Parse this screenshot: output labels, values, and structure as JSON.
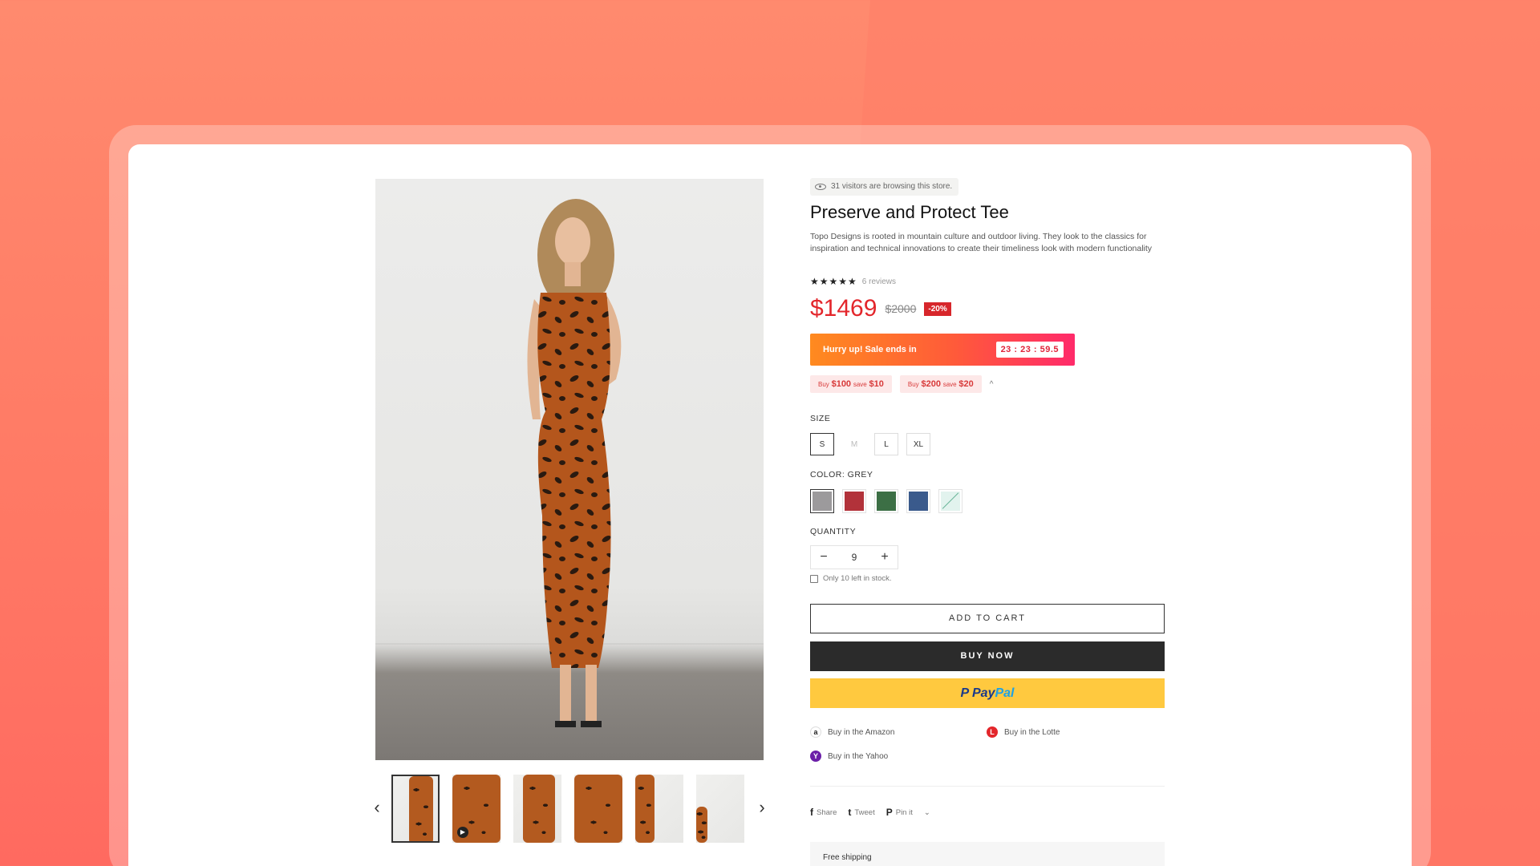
{
  "product": {
    "visitors_text": "31 visitors are browsing this store.",
    "title": "Preserve and Protect Tee",
    "description": "Topo Designs is rooted in mountain culture and outdoor living. They look to the classics for inspiration and technical innovations to create their timeliness look with modern functionality",
    "rating_stars": "★★★★★",
    "reviews": "6 reviews",
    "price": "$1469",
    "old_price": "$2000",
    "discount": "-20%"
  },
  "sale": {
    "text": "Hurry up! Sale ends in",
    "timer": "23 : 23 : 59.5"
  },
  "offers": [
    {
      "prefix": "Buy",
      "amount": "$100",
      "mid": "save",
      "save": "$10"
    },
    {
      "prefix": "Buy",
      "amount": "$200",
      "mid": "save",
      "save": "$20"
    }
  ],
  "size": {
    "label": "SIZE",
    "options": [
      "S",
      "M",
      "L",
      "XL"
    ],
    "selected": "S"
  },
  "color": {
    "label": "COLOR: GREY",
    "swatches": [
      {
        "name": "grey",
        "hex": "#9c9a9c"
      },
      {
        "name": "red",
        "hex": "#b2323a"
      },
      {
        "name": "green",
        "hex": "#3c6f45"
      },
      {
        "name": "blue",
        "hex": "#3a5a8c"
      },
      {
        "name": "mint",
        "hex": "#e2f3ee"
      }
    ]
  },
  "quantity": {
    "label": "QUANTITY",
    "value": "9",
    "minus": "−",
    "plus": "+",
    "stock_text": "Only 10 left in stock."
  },
  "buttons": {
    "add_to_cart": "ADD TO CART",
    "buy_now": "BUY NOW",
    "paypal_1": "P Pay",
    "paypal_2": "Pal"
  },
  "stores": [
    {
      "label": "Buy in the Amazon",
      "icon": "amazon-icon",
      "glyph": "a",
      "color": "#ffffff"
    },
    {
      "label": "Buy in the Lotte",
      "icon": "lotte-icon",
      "glyph": "L",
      "color": "#e3262b"
    },
    {
      "label": "Buy in the Yahoo",
      "icon": "yahoo-icon",
      "glyph": "Y",
      "color": "#6b1fa8"
    }
  ],
  "share": [
    {
      "label": "Share",
      "glyph": "f"
    },
    {
      "label": "Tweet",
      "glyph": "t"
    },
    {
      "label": "Pin it",
      "glyph": "P"
    }
  ],
  "shipping": "Free shipping",
  "gallery": {
    "prev": "‹",
    "next": "›"
  }
}
